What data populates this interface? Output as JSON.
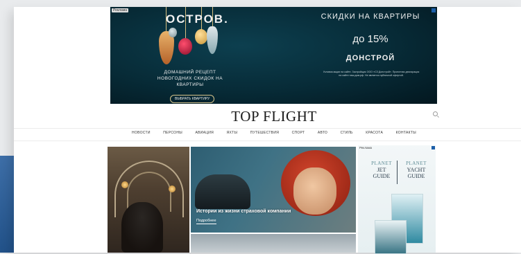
{
  "banner": {
    "ad_tag": "Реклама",
    "left_brand": "ОСТРОВ.",
    "left_sub": "ДОМАШНИЙ РЕЦЕПТ НОВОГОДНИХ СКИДОК НА КВАРТИРЫ",
    "left_button": "ВЫБРАТЬ КВАРТИРУ",
    "right_title": "СКИДКИ НА КВАРТИРЫ",
    "right_pct": "до 15%",
    "right_brand": "ДОНСТРОЙ",
    "fine_print": "Условия акции на сайте. Застройщик ООО «СЗ Донстрой». Проектная декларация на сайте наш.дом.рф. Не является публичной офертой."
  },
  "header": {
    "logo": "TOP FLIGHT"
  },
  "nav": {
    "items": [
      "НОВОСТИ",
      "ПЕРСОНЫ",
      "АВИАЦИЯ",
      "ЯХТЫ",
      "ПУТЕШЕСТВИЯ",
      "СПОРТ",
      "АВТО",
      "СТИЛЬ",
      "КРАСОТА",
      "КОНТАКТЫ"
    ]
  },
  "hero": {
    "title": "Истории из жизни страховой компании",
    "more": "Подробнее"
  },
  "side_ad": {
    "label": "Реклама",
    "left_top": "PLANET",
    "left_mid": "JET",
    "left_bottom": "GUIDE",
    "right_top": "PLANET",
    "right_mid": "YACHT",
    "right_bottom": "GUIDE"
  }
}
